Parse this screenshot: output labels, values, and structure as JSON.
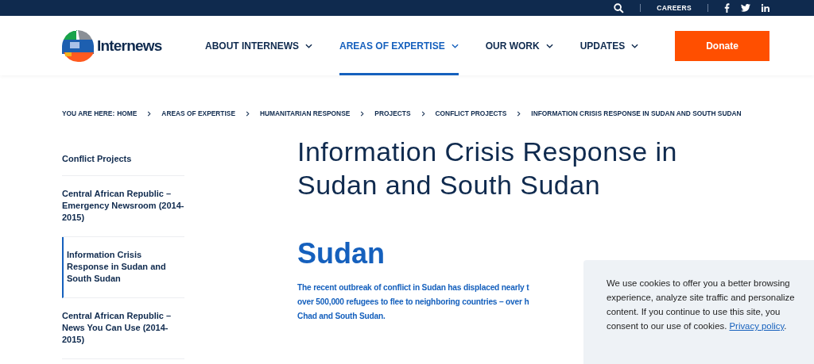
{
  "top_bar": {
    "links": [
      "CAREERS"
    ]
  },
  "header": {
    "logo_text": "Internews",
    "nav": [
      {
        "label": "ABOUT INTERNEWS",
        "selected": false
      },
      {
        "label": "AREAS OF EXPERTISE",
        "selected": true
      },
      {
        "label": "OUR WORK",
        "selected": false
      },
      {
        "label": "UPDATES",
        "selected": false
      }
    ],
    "donate": "Donate"
  },
  "breadcrumb": {
    "prefix": "YOU ARE HERE:",
    "items": [
      "HOME",
      "AREAS OF EXPERTISE",
      "HUMANITARIAN RESPONSE",
      "PROJECTS",
      "CONFLICT PROJECTS",
      "INFORMATION CRISIS RESPONSE IN SUDAN AND SOUTH SUDAN"
    ]
  },
  "sidebar": {
    "heading": "Conflict Projects",
    "items": [
      {
        "label": "Central African Republic – Emergency Newsroom (2014-2015)",
        "selected": false
      },
      {
        "label": "Information Crisis Response in Sudan and South Sudan",
        "selected": true
      },
      {
        "label": "Central African Republic – News You Can Use (2014-2015)",
        "selected": false
      }
    ]
  },
  "article": {
    "title": "Information Crisis Response in Sudan and South Sudan",
    "section_heading": "Sudan",
    "lead_lines": [
      "The recent outbreak of conflict in Sudan has displaced nearly t",
      "over 500,000 refugees to flee to neighboring countries – over h",
      "Chad and South Sudan."
    ]
  },
  "cookie_notice": {
    "text": "We use cookies to offer you a better browsing experience, analyze site traffic and personalize content. If you continue to use this site, you consent to our use of cookies.",
    "link": "Privacy policy",
    "after_link": "."
  }
}
